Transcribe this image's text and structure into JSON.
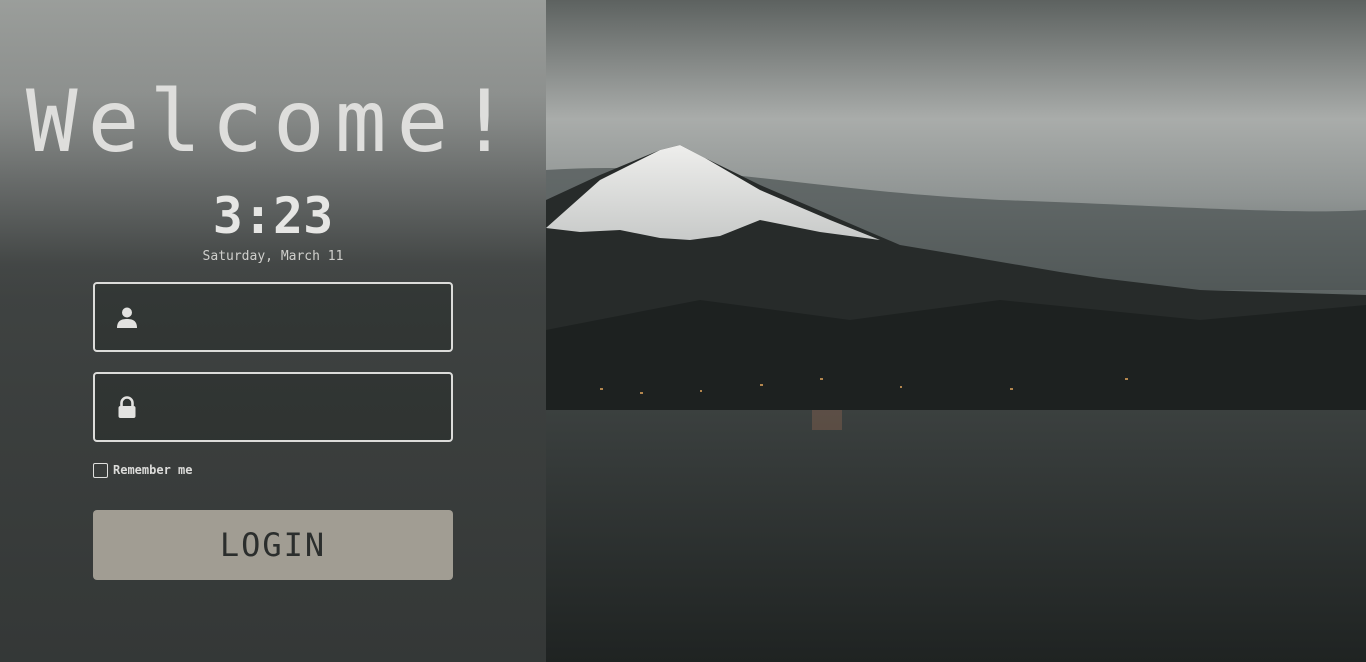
{
  "greeting": "Welcome!",
  "clock": {
    "time": "3:23",
    "date": "Saturday, March 11"
  },
  "form": {
    "username": {
      "value": "",
      "placeholder": "",
      "icon": "user-icon"
    },
    "password": {
      "value": "",
      "placeholder": "",
      "icon": "lock-icon"
    },
    "remember_label": "Remember me",
    "remember_checked": false,
    "login_label": "LOGIN"
  },
  "background": {
    "description_icon": "mountain-landscape-image"
  },
  "colors": {
    "button_bg": "#a19d93",
    "button_text": "#2b2e2d",
    "field_border": "#dcdcda",
    "text": "#dededc"
  }
}
